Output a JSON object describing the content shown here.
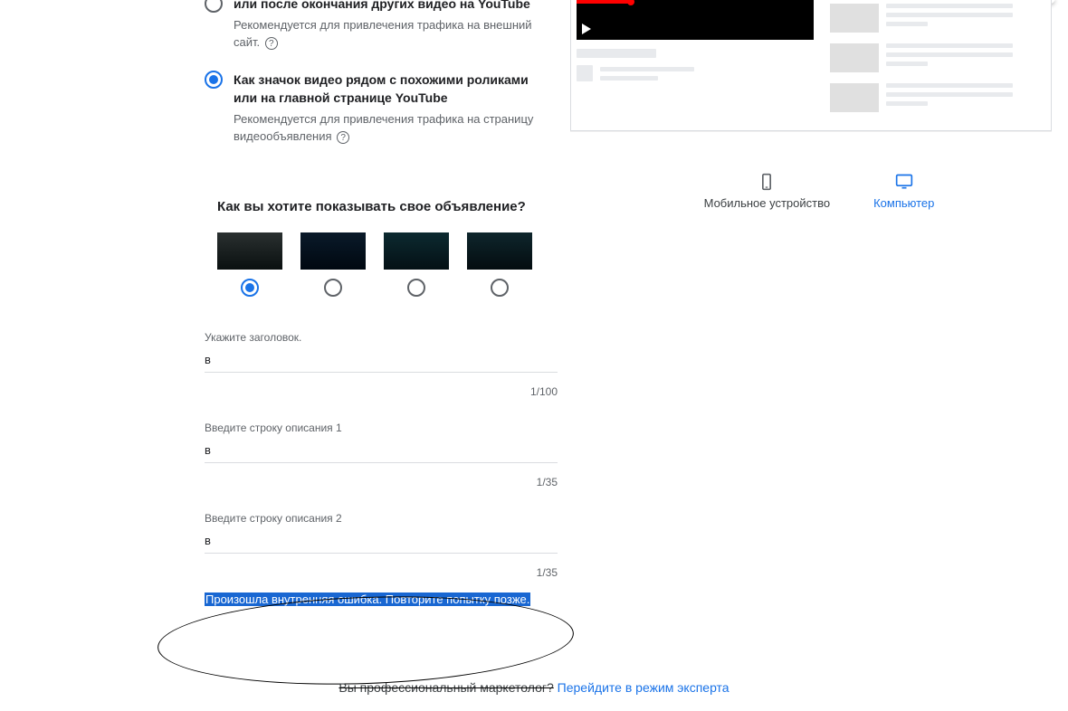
{
  "options": {
    "opt1": {
      "title": "или после окончания других видео на YouTube",
      "desc": "Рекомендуется для привлечения трафика на внешний сайт."
    },
    "opt2": {
      "title": "Как значок видео рядом с похожими роликами или на главной странице YouTube",
      "desc": "Рекомендуется для привлечения трафика на страницу видеообъявления"
    }
  },
  "howShow": "Как вы хотите показывать свое объявление?",
  "fields": {
    "headline": {
      "label": "Укажите заголовок.",
      "value": "в",
      "counter": "1/100"
    },
    "desc1": {
      "label": "Введите строку описания 1",
      "value": "в",
      "counter": "1/35"
    },
    "desc2": {
      "label": "Введите строку описания 2",
      "value": "в",
      "counter": "1/35"
    }
  },
  "error": "Произошла внутренняя ошибка. Повторите попытку позже.",
  "footer": {
    "question": "Вы профессиональный маркетолог?",
    "link": "Перейдите в режим эксперта"
  },
  "devices": {
    "mobile": "Мобильное устройство",
    "desktop": "Компьютер"
  },
  "helpGlyph": "?"
}
